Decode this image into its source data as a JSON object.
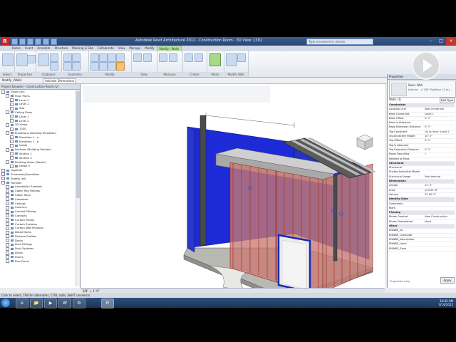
{
  "window": {
    "title": "Autodesk Revit Architecture 2012 - Construction Room - 3D View: {3D}",
    "help_placeholder": "Type a keyword or phrase",
    "controls": [
      "–",
      "□",
      "×"
    ]
  },
  "ribbon": {
    "tabs": [
      {
        "label": "Home",
        "active": false
      },
      {
        "label": "Insert",
        "active": false
      },
      {
        "label": "Annotate",
        "active": false
      },
      {
        "label": "Structure",
        "active": false
      },
      {
        "label": "Massing & Site",
        "active": false
      },
      {
        "label": "Collaborate",
        "active": false
      },
      {
        "label": "View",
        "active": false
      },
      {
        "label": "Manage",
        "active": false
      },
      {
        "label": "Modify",
        "active": false
      },
      {
        "label": "Modify | Walls",
        "active": true,
        "context": true
      }
    ],
    "panels": [
      "Select",
      "Properties",
      "Clipboard",
      "Geometry",
      "Modify",
      "View",
      "Measure",
      "Create",
      "Mode",
      "Modify Wall"
    ]
  },
  "options_bar": {
    "label": "Modify | Walls",
    "activate_label": "Activate Dimensions"
  },
  "project_browser": {
    "title": "Project Browser - Construction Room.rvt",
    "items": [
      {
        "label": "Views (all)",
        "depth": 0
      },
      {
        "label": "Floor Plans",
        "depth": 1
      },
      {
        "label": "Level 1",
        "depth": 2
      },
      {
        "label": "Level 2",
        "depth": 2
      },
      {
        "label": "Site",
        "depth": 2
      },
      {
        "label": "Ceiling Plans",
        "depth": 1
      },
      {
        "label": "Level 1",
        "depth": 2
      },
      {
        "label": "Level 2",
        "depth": 2
      },
      {
        "label": "3D Views",
        "depth": 1
      },
      {
        "label": "{3D}",
        "depth": 2
      },
      {
        "label": "Elevations (Building Elevation)",
        "depth": 1
      },
      {
        "label": "Elevation 1 - a",
        "depth": 2
      },
      {
        "label": "Elevation 1 - b",
        "depth": 2
      },
      {
        "label": "Inside",
        "depth": 2
      },
      {
        "label": "Sections (Building Section)",
        "depth": 1
      },
      {
        "label": "Section 1",
        "depth": 2
      },
      {
        "label": "Section 2",
        "depth": 2
      },
      {
        "label": "Drafting Views (Detail)",
        "depth": 1
      },
      {
        "label": "Detail 0",
        "depth": 2
      },
      {
        "label": "Legends",
        "depth": 0
      },
      {
        "label": "Schedules/Quantities",
        "depth": 0
      },
      {
        "label": "Sheets (all)",
        "depth": 0
      },
      {
        "label": "Families",
        "depth": 0
      },
      {
        "label": "Annotation Symbols",
        "depth": 1
      },
      {
        "label": "Cable Tray Fittings",
        "depth": 1
      },
      {
        "label": "Cable Trays",
        "depth": 1
      },
      {
        "label": "Casework",
        "depth": 1
      },
      {
        "label": "Ceilings",
        "depth": 1
      },
      {
        "label": "Columns",
        "depth": 1
      },
      {
        "label": "Conduit Fittings",
        "depth": 1
      },
      {
        "label": "Conduits",
        "depth": 1
      },
      {
        "label": "Curtain Panels",
        "depth": 1
      },
      {
        "label": "Curtain Systems",
        "depth": 1
      },
      {
        "label": "Curtain Wall Mullions",
        "depth": 1
      },
      {
        "label": "Detail Items",
        "depth": 1
      },
      {
        "label": "Division Profiles",
        "depth": 1
      },
      {
        "label": "Doors",
        "depth": 1
      },
      {
        "label": "Duct Fittings",
        "depth": 1
      },
      {
        "label": "Duct Systems",
        "depth": 1
      },
      {
        "label": "Ducts",
        "depth": 1
      },
      {
        "label": "Floors",
        "depth": 1
      },
      {
        "label": "Flex Ducts",
        "depth": 1
      }
    ]
  },
  "view": {
    "name": "{3D}",
    "view_control": "1/8\" = 1'-0\""
  },
  "properties": {
    "title": "Properties",
    "type_family": "Basic Wall",
    "type_name": "Interior - 4 7/8\" Partition (1-hr)",
    "instance_label": "Walls (1)",
    "edit_type": "Edit Type",
    "rows": [
      {
        "label": "Constraints",
        "value": "",
        "group": true
      },
      {
        "label": "Location Line",
        "value": "Wall Centerline"
      },
      {
        "label": "Base Constraint",
        "value": "Level 1"
      },
      {
        "label": "Base Offset",
        "value": "0' 0\""
      },
      {
        "label": "Base is Attached",
        "value": ""
      },
      {
        "label": "Base Extension Distance",
        "value": "0' 0\""
      },
      {
        "label": "Top Constraint",
        "value": "Up to level: Level 2"
      },
      {
        "label": "Unconnected Height",
        "value": "10' 0\""
      },
      {
        "label": "Top Offset",
        "value": "0' 0\""
      },
      {
        "label": "Top is Attached",
        "value": ""
      },
      {
        "label": "Top Extension Distance",
        "value": "0' 0\""
      },
      {
        "label": "Room Bounding",
        "value": "✓"
      },
      {
        "label": "Related to Mass",
        "value": ""
      },
      {
        "label": "Structural",
        "value": "",
        "group": true
      },
      {
        "label": "Structural",
        "value": ""
      },
      {
        "label": "Enable Analytical Model",
        "value": ""
      },
      {
        "label": "Structural Usage",
        "value": "Non-bearing"
      },
      {
        "label": "Dimensions",
        "value": "",
        "group": true
      },
      {
        "label": "Length",
        "value": "12' 0\""
      },
      {
        "label": "Area",
        "value": "120.00 SF"
      },
      {
        "label": "Volume",
        "value": "32.50 CF"
      },
      {
        "label": "Identity Data",
        "value": "",
        "group": true
      },
      {
        "label": "Comments",
        "value": ""
      },
      {
        "label": "Mark",
        "value": ""
      },
      {
        "label": "Phasing",
        "value": "",
        "group": true
      },
      {
        "label": "Phase Created",
        "value": "New Construction"
      },
      {
        "label": "Phase Demolished",
        "value": "None"
      },
      {
        "label": "Other",
        "value": "",
        "group": true
      },
      {
        "label": "ENWBS_no",
        "value": ""
      },
      {
        "label": "ENWBS_CostCode",
        "value": ""
      },
      {
        "label": "ENWBS_Description",
        "value": ""
      },
      {
        "label": "ENWBS_Level",
        "value": ""
      },
      {
        "label": "ENWBS_Zone",
        "value": ""
      }
    ],
    "help_link": "Properties help",
    "apply": "Apply"
  },
  "status": {
    "text": "Click to select, TAB for alternates, CTRL adds, SHIFT unselects."
  },
  "taskbar": {
    "apps": [
      "e",
      "📁",
      "▶",
      "W",
      "⚙",
      "R"
    ],
    "time": "10:42 AM",
    "date": "3/14/2012"
  },
  "colors": {
    "wall_blue": "#1d2bd6",
    "wall_red": "#c87a73",
    "stud_red": "#c0392b",
    "accent": "#2a4572"
  }
}
